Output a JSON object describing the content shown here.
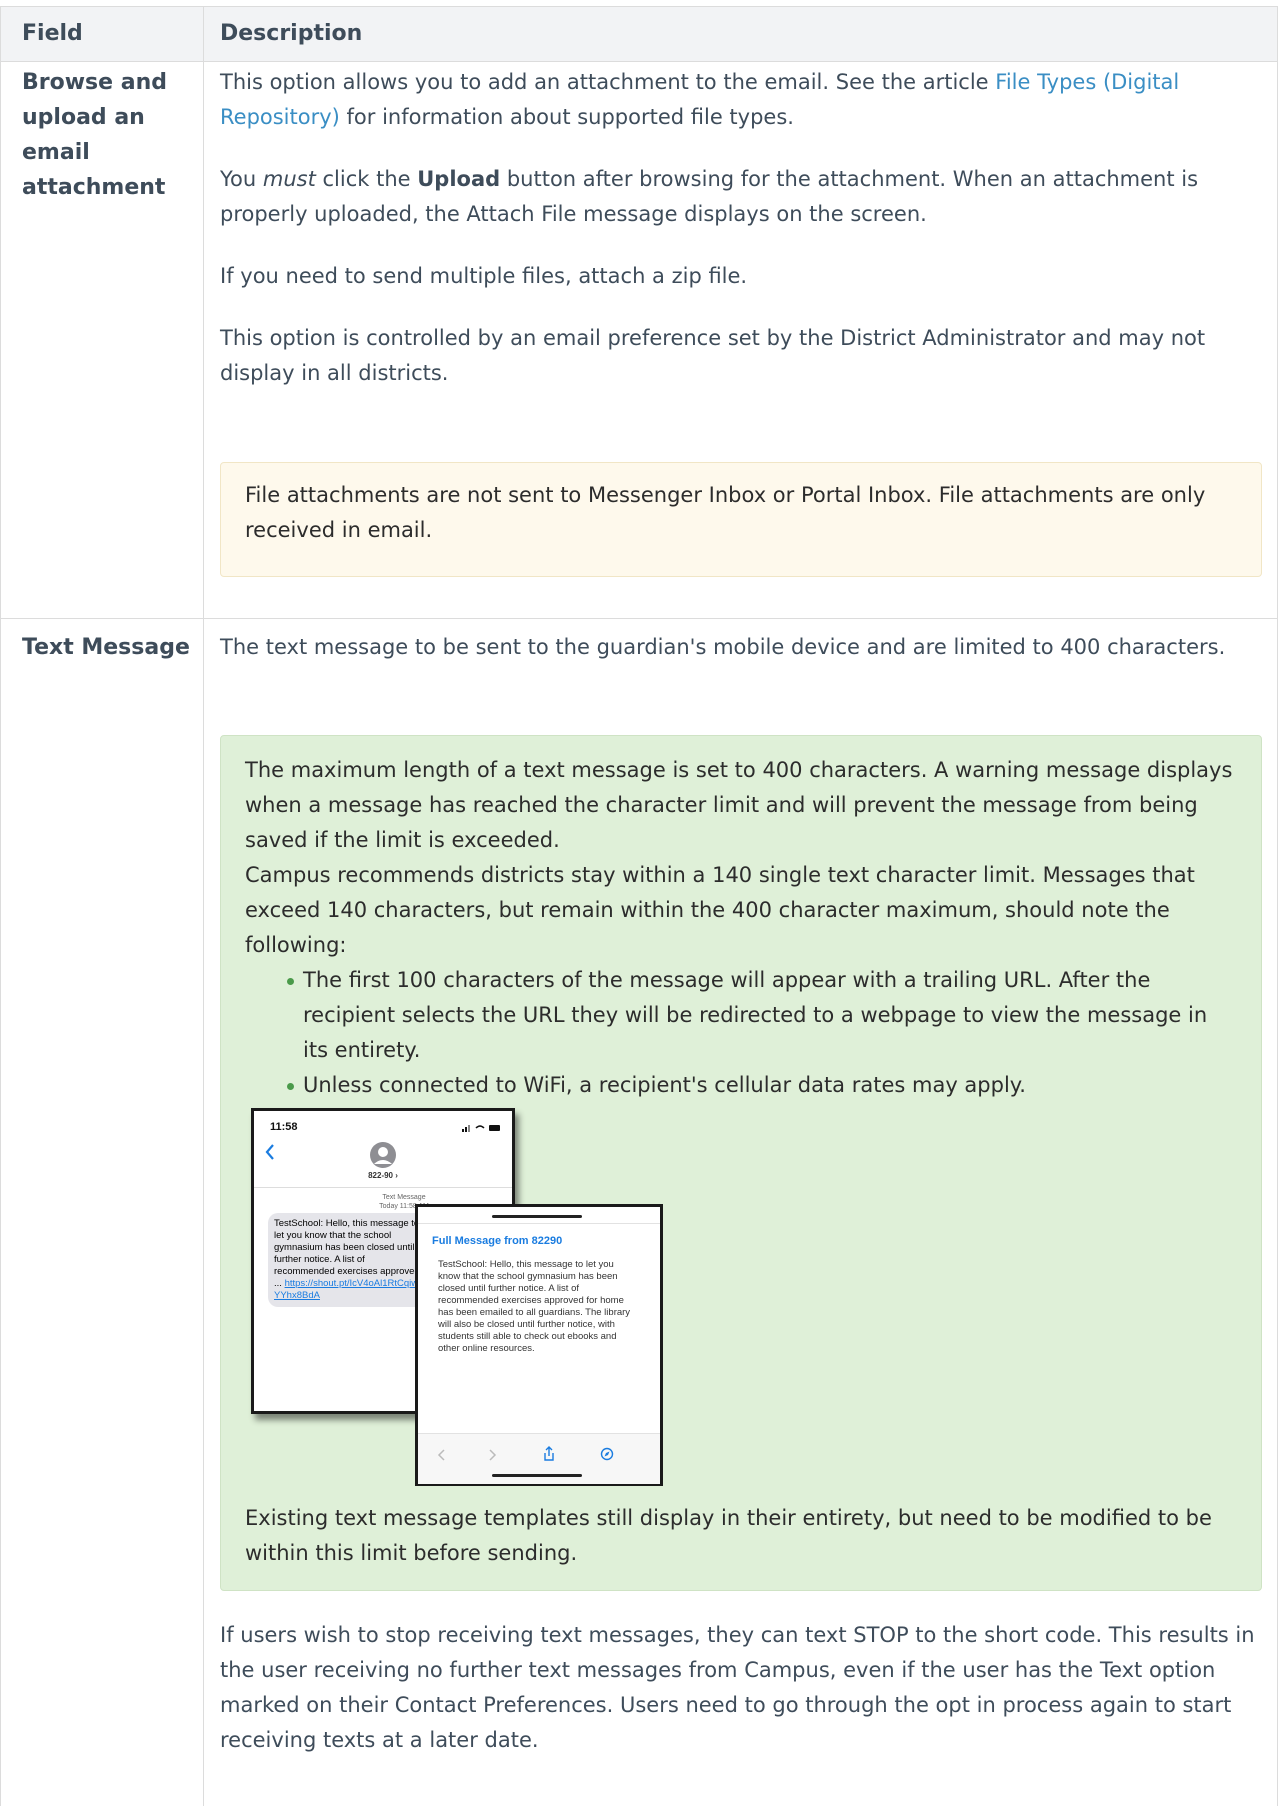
{
  "table": {
    "headers": {
      "field": "Field",
      "description": "Description"
    },
    "rows": [
      {
        "field": "Browse and upload an email attachment",
        "desc": {
          "p1_before": "This option allows you to add an attachment to the email. See the article ",
          "p1_link": "File Types (Digital Repository)",
          "p1_after": " for information about supported file types.",
          "p2_a": "You ",
          "p2_em": "must",
          "p2_b": " click the ",
          "p2_strong": "Upload",
          "p2_c": " button after browsing for the attachment. When an attachment is properly uploaded, the Attach File message displays on the screen.",
          "p3": "If you need to send multiple files, attach a zip file.",
          "p4": "This option is controlled by an email preference set by the District Administrator and may not display in all districts.",
          "warning": "File attachments are not sent to Messenger Inbox or Portal Inbox. File attachments are only received in email."
        }
      },
      {
        "field": "Text Message",
        "desc": {
          "p1": "The text message to be sent to the guardian's mobile device and are limited to 400 characters.",
          "tip_p1": "The maximum length of a text message is set to 400 characters. A warning message displays when a message has reached the character limit and will prevent the message from being saved if the limit is exceeded.",
          "tip_p2": "Campus recommends districts stay within a 140 single text character limit.  Messages that exceed 140 characters, but remain within the 400 character maximum, should note the following:",
          "tip_bullets": [
            "The first 100 characters of the message will appear with a trailing URL. After the recipient selects the URL they will be redirected to a webpage to view the message in its entirety.",
            "Unless connected to WiFi, a recipient's cellular data rates may apply."
          ],
          "tip_p3": "Existing text message templates still display in their entirety, but need to be modified to be within this limit before sending.",
          "p_last": "If users wish to stop receiving text messages, they can text STOP to the short code. This results in the user receiving no further text messages from Campus, even if the user has the Text option marked on their Contact Preferences. Users need to go through the opt in process again to start receiving texts at a later date."
        }
      }
    ]
  },
  "phone1": {
    "time": "11:58",
    "contact": "822-90 ›",
    "meta_line1": "Text Message",
    "meta_line2": "Today 11:58 AM",
    "bubble_text": "TestSchool: Hello, this message to let you know that the school gymnasium has been closed until further notice. A list of recommended exercises approved ... ",
    "bubble_link": "https://shout.pt/IcV4oAl1RtCqiwYYhx8BdA"
  },
  "phone2": {
    "title": "Full Message from 82290",
    "body": "TestSchool: Hello, this message to let you know that the school gymnasium has been closed until further notice. A list of recommended exercises approved for home has been emailed to all guardians. The library will also be closed until further notice, with students still able to check out ebooks and other online resources."
  },
  "colors": {
    "link": "#3a8ec4",
    "warning_bg": "#fef9ec",
    "tip_bg": "#dff0d8",
    "header_bg": "#f2f3f5",
    "ios_blue": "#1a7ce0"
  },
  "icons": [
    "chevron-left-icon",
    "avatar-icon",
    "signal-icon",
    "wifi-icon",
    "battery-icon",
    "share-icon",
    "compass-icon"
  ]
}
